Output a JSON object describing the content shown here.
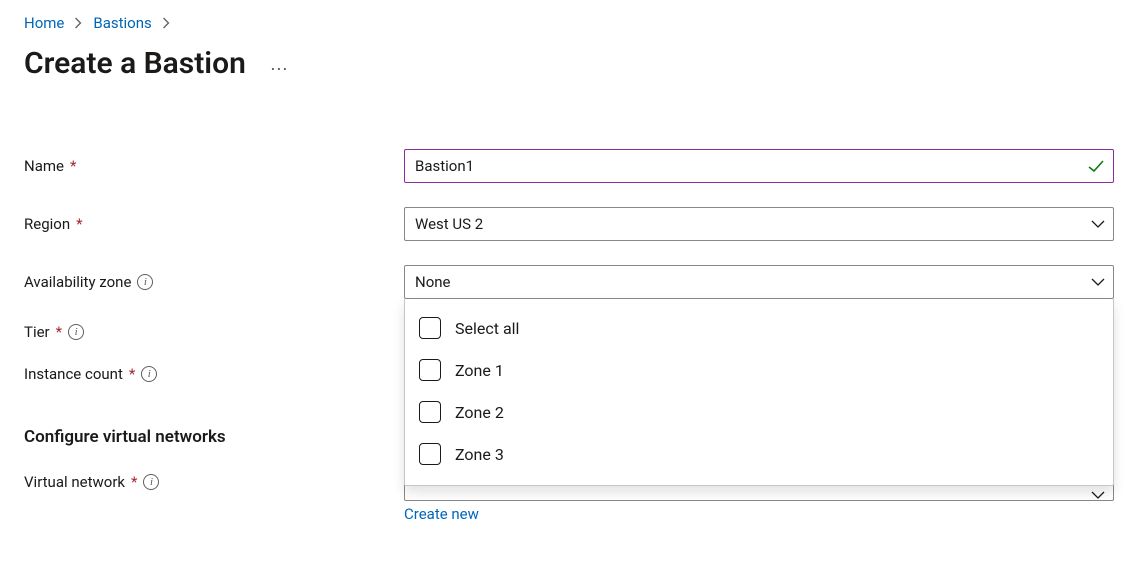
{
  "breadcrumb": {
    "items": [
      "Home",
      "Bastions"
    ]
  },
  "page": {
    "title": "Create a Bastion"
  },
  "form": {
    "name": {
      "label": "Name",
      "required": true,
      "value": "Bastion1"
    },
    "region": {
      "label": "Region",
      "required": true,
      "value": "West US 2"
    },
    "availability_zone": {
      "label": "Availability zone",
      "required": false,
      "value": "None",
      "options": {
        "select_all": "Select all",
        "zone1": "Zone 1",
        "zone2": "Zone 2",
        "zone3": "Zone 3"
      }
    },
    "tier": {
      "label": "Tier",
      "required": true
    },
    "instance_count": {
      "label": "Instance count",
      "required": true
    }
  },
  "vnet_section": {
    "title": "Configure virtual networks",
    "virtual_network": {
      "label": "Virtual network",
      "required": true,
      "value": "",
      "create_new": "Create new"
    }
  }
}
